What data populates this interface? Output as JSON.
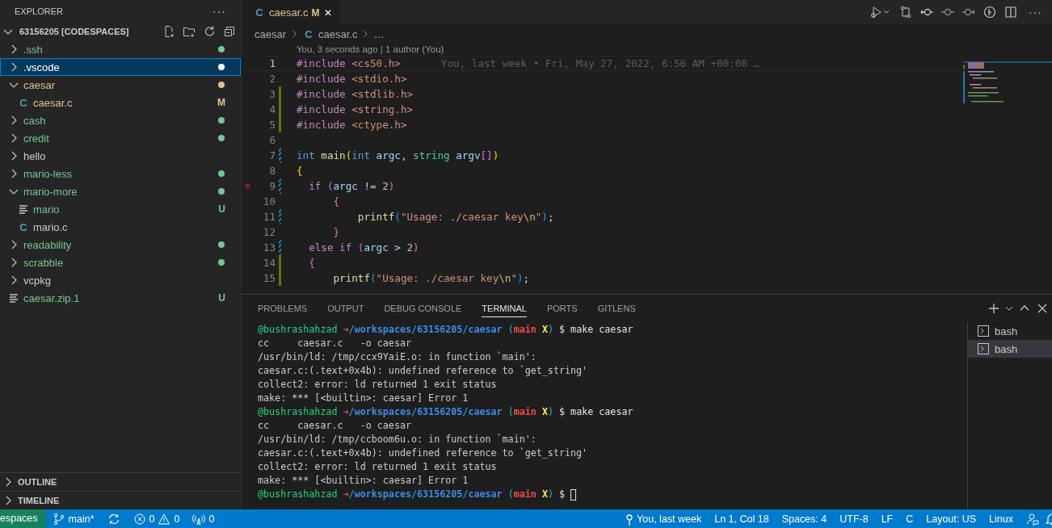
{
  "sidebar": {
    "title": "EXPLORER",
    "more": "···",
    "root": {
      "label": "63156205 [CODESPACES]",
      "expanded": true
    },
    "items": [
      {
        "name": ".ssh",
        "kind": "folder",
        "expanded": false,
        "selected": false,
        "color": "#73c991",
        "dot": true
      },
      {
        "name": ".vscode",
        "kind": "folder",
        "expanded": false,
        "selected": true,
        "color": "#ffffff",
        "dot": true
      },
      {
        "name": "caesar",
        "kind": "folder",
        "expanded": true,
        "selected": false,
        "color": "#e2c08d",
        "dot": true,
        "children": [
          {
            "name": "caesar.c",
            "kind": "c-file",
            "icon": "C",
            "selected": false,
            "color": "#e2c08d",
            "dot": false,
            "badge": "M"
          }
        ]
      },
      {
        "name": "cash",
        "kind": "folder",
        "expanded": false,
        "selected": false,
        "color": "#73c991",
        "dot": true
      },
      {
        "name": "credit",
        "kind": "folder",
        "expanded": false,
        "selected": false,
        "color": "#73c991",
        "dot": true
      },
      {
        "name": "hello",
        "kind": "folder",
        "expanded": false,
        "selected": false,
        "color": "#cccccc",
        "dot": false
      },
      {
        "name": "mario-less",
        "kind": "folder",
        "expanded": false,
        "selected": false,
        "color": "#73c991",
        "dot": true
      },
      {
        "name": "mario-more",
        "kind": "folder",
        "expanded": true,
        "selected": false,
        "color": "#73c991",
        "dot": true,
        "children": [
          {
            "name": "mario",
            "kind": "text-file",
            "selected": false,
            "color": "#73c991",
            "dot": false,
            "badge": "U"
          },
          {
            "name": "mario.c",
            "kind": "c-file",
            "icon": "C",
            "selected": false,
            "color": "#cccccc",
            "dot": false
          }
        ]
      },
      {
        "name": "readability",
        "kind": "folder",
        "expanded": false,
        "selected": false,
        "color": "#73c991",
        "dot": true
      },
      {
        "name": "scrabble",
        "kind": "folder",
        "expanded": false,
        "selected": false,
        "color": "#73c991",
        "dot": true
      },
      {
        "name": "vcpkg",
        "kind": "folder",
        "expanded": false,
        "selected": false,
        "color": "#cccccc",
        "dot": false
      },
      {
        "name": "caesar.zip.1",
        "kind": "text-file",
        "selected": false,
        "color": "#73c991",
        "dot": false,
        "badge": "U"
      }
    ],
    "sections": [
      {
        "label": "OUTLINE",
        "expanded": false
      },
      {
        "label": "TIMELINE",
        "expanded": false
      }
    ]
  },
  "editor": {
    "tab": {
      "icon": "C",
      "label": "caesar.c",
      "badge": "M",
      "close": "✕"
    },
    "breadcrumb": [
      {
        "label": "caesar"
      },
      {
        "icon": "C",
        "label": "caesar.c"
      },
      {
        "label": "…"
      }
    ],
    "codelens": "You, 3 seconds ago | 1 author (You)",
    "blame": "You, last week • Fri, May 27, 2022, 6:56 AM +00:00 …",
    "lines": [
      {
        "n": "1",
        "current": true,
        "added": false,
        "modified": false,
        "breakpoint": false,
        "segs": [
          {
            "text": "#include",
            "kind": "directive"
          },
          {
            "text": " <cs50.h>",
            "kind": "string"
          }
        ]
      },
      {
        "n": "2",
        "current": false,
        "added": false,
        "modified": false,
        "breakpoint": false,
        "segs": [
          {
            "text": "#include",
            "kind": "directive"
          },
          {
            "text": " <stdio.h>",
            "kind": "string"
          }
        ]
      },
      {
        "n": "3",
        "current": false,
        "added": true,
        "modified": false,
        "breakpoint": false,
        "segs": [
          {
            "text": "#include",
            "kind": "directive"
          },
          {
            "text": " <stdlib.h>",
            "kind": "string"
          }
        ]
      },
      {
        "n": "4",
        "current": false,
        "added": true,
        "modified": false,
        "breakpoint": false,
        "segs": [
          {
            "text": "#include",
            "kind": "directive"
          },
          {
            "text": " <string.h>",
            "kind": "string"
          }
        ]
      },
      {
        "n": "5",
        "current": false,
        "added": true,
        "modified": false,
        "breakpoint": false,
        "segs": [
          {
            "text": "#include",
            "kind": "directive"
          },
          {
            "text": " <ctype.h>",
            "kind": "string"
          }
        ]
      },
      {
        "n": "6",
        "current": false,
        "added": false,
        "modified": false,
        "breakpoint": false
      },
      {
        "n": "7",
        "current": false,
        "added": false,
        "modified": true,
        "breakpoint": false,
        "segs": [
          {
            "text": "int",
            "kind": "keyword"
          },
          {
            "text": " main",
            "kind": "function"
          },
          {
            "text": "(",
            "kind": "bracket1"
          },
          {
            "text": "int",
            "kind": "keyword"
          },
          {
            "text": " argc",
            "kind": "variable"
          },
          {
            "text": ", ",
            "kind": "plain"
          },
          {
            "text": "string",
            "kind": "type"
          },
          {
            "text": " argv",
            "kind": "variable"
          },
          {
            "text": "[]",
            "kind": "bracket2"
          },
          {
            "text": ")",
            "kind": "bracket1"
          }
        ]
      },
      {
        "n": "8",
        "current": false,
        "added": false,
        "modified": false,
        "breakpoint": false,
        "segs": [
          {
            "text": "{",
            "kind": "bracket1"
          }
        ]
      },
      {
        "n": "9",
        "current": false,
        "added": false,
        "modified": true,
        "breakpoint": true,
        "segs": [
          {
            "text": "  if ",
            "kind": "control"
          },
          {
            "text": "(",
            "kind": "bracket2"
          },
          {
            "text": "argc",
            "kind": "variable"
          },
          {
            "text": " != ",
            "kind": "plain"
          },
          {
            "text": "2",
            "kind": "number"
          },
          {
            "text": ")",
            "kind": "bracket2"
          }
        ]
      },
      {
        "n": "10",
        "current": false,
        "added": false,
        "modified": false,
        "breakpoint": false,
        "segs": [
          {
            "text": "      {",
            "kind": "bracket2"
          }
        ]
      },
      {
        "n": "11",
        "current": false,
        "added": false,
        "modified": true,
        "breakpoint": false,
        "segs": [
          {
            "text": "          printf",
            "kind": "function"
          },
          {
            "text": "(",
            "kind": "bracket3"
          },
          {
            "text": "\"Usage: ./caesar key",
            "kind": "string"
          },
          {
            "text": "\\n",
            "kind": "escape"
          },
          {
            "text": "\"",
            "kind": "string"
          },
          {
            "text": ")",
            "kind": "bracket3"
          },
          {
            "text": ";",
            "kind": "plain"
          }
        ]
      },
      {
        "n": "12",
        "current": false,
        "added": false,
        "modified": false,
        "breakpoint": false,
        "segs": [
          {
            "text": "      }",
            "kind": "bracket2"
          }
        ]
      },
      {
        "n": "13",
        "current": false,
        "added": false,
        "modified": true,
        "breakpoint": false,
        "segs": [
          {
            "text": "  else if ",
            "kind": "control"
          },
          {
            "text": "(",
            "kind": "bracket2"
          },
          {
            "text": "argc",
            "kind": "variable"
          },
          {
            "text": " > ",
            "kind": "plain"
          },
          {
            "text": "2",
            "kind": "number"
          },
          {
            "text": ")",
            "kind": "bracket2"
          }
        ]
      },
      {
        "n": "14",
        "current": false,
        "added": true,
        "modified": false,
        "breakpoint": false,
        "segs": [
          {
            "text": "  {",
            "kind": "bracket2"
          }
        ]
      },
      {
        "n": "15",
        "current": false,
        "added": true,
        "modified": false,
        "breakpoint": false,
        "segs": [
          {
            "text": "      printf",
            "kind": "function"
          },
          {
            "text": "(",
            "kind": "bracket3"
          },
          {
            "text": "\"Usage: ./caesar key",
            "kind": "string"
          },
          {
            "text": "\\n",
            "kind": "escape"
          },
          {
            "text": "\"",
            "kind": "string"
          },
          {
            "text": ")",
            "kind": "bracket3"
          },
          {
            "text": ";",
            "kind": "plain"
          }
        ]
      }
    ]
  },
  "panel": {
    "tabs": [
      {
        "label": "PROBLEMS",
        "selected": false
      },
      {
        "label": "OUTPUT",
        "selected": false
      },
      {
        "label": "DEBUG CONSOLE",
        "selected": false
      },
      {
        "label": "TERMINAL",
        "selected": true
      },
      {
        "label": "PORTS",
        "selected": false
      },
      {
        "label": "GITLENS",
        "selected": false
      }
    ],
    "terminal_lines": [
      {
        "kind": "prompt",
        "user": "@bushrashahzad",
        "arrow": "➜",
        "path": "/workspaces/63156205/caesar",
        "open": "(",
        "branch": "main",
        "mark": "X",
        "close": ")",
        "command": "$ make caesar",
        "cursor": false
      },
      {
        "kind": "output",
        "text": "cc     caesar.c   -o caesar"
      },
      {
        "kind": "output",
        "text": "/usr/bin/ld: /tmp/ccx9YaiE.o: in function `main':"
      },
      {
        "kind": "output",
        "text": "caesar.c:(.text+0x4b): undefined reference to `get_string'"
      },
      {
        "kind": "output",
        "text": "collect2: error: ld returned 1 exit status"
      },
      {
        "kind": "output",
        "text": "make: *** [<builtin>: caesar] Error 1"
      },
      {
        "kind": "prompt",
        "user": "@bushrashahzad",
        "arrow": "➜",
        "path": "/workspaces/63156205/caesar",
        "open": "(",
        "branch": "main",
        "mark": "X",
        "close": ")",
        "command": "$ make caesar",
        "cursor": false
      },
      {
        "kind": "output",
        "text": "cc     caesar.c   -o caesar"
      },
      {
        "kind": "output",
        "text": "/usr/bin/ld: /tmp/ccboom6u.o: in function `main':"
      },
      {
        "kind": "output",
        "text": "caesar.c:(.text+0x4b): undefined reference to `get_string'"
      },
      {
        "kind": "output",
        "text": "collect2: error: ld returned 1 exit status"
      },
      {
        "kind": "output",
        "text": "make: *** [<builtin>: caesar] Error 1"
      },
      {
        "kind": "prompt",
        "user": "@bushrashahzad",
        "arrow": "➜",
        "path": "/workspaces/63156205/caesar",
        "open": "(",
        "branch": "main",
        "mark": "X",
        "close": ")",
        "command": "$",
        "cursor": true
      }
    ],
    "terminals": [
      {
        "label": "bash",
        "selected": false
      },
      {
        "label": "bash",
        "selected": true
      }
    ]
  },
  "status_bar": {
    "remote": "espaces",
    "branch": "main*",
    "errors": "0",
    "warnings": "0",
    "ports": "0",
    "right": [
      {
        "kind": "blame",
        "text": "You, last week"
      },
      {
        "kind": "text",
        "text": "Ln 1, Col 18"
      },
      {
        "kind": "text",
        "text": "Spaces: 4"
      },
      {
        "kind": "text",
        "text": "UTF-8"
      },
      {
        "kind": "text",
        "text": "LF"
      },
      {
        "kind": "text",
        "text": "C"
      },
      {
        "kind": "text",
        "text": "Layout: US"
      },
      {
        "kind": "text",
        "text": "Linux"
      }
    ]
  }
}
